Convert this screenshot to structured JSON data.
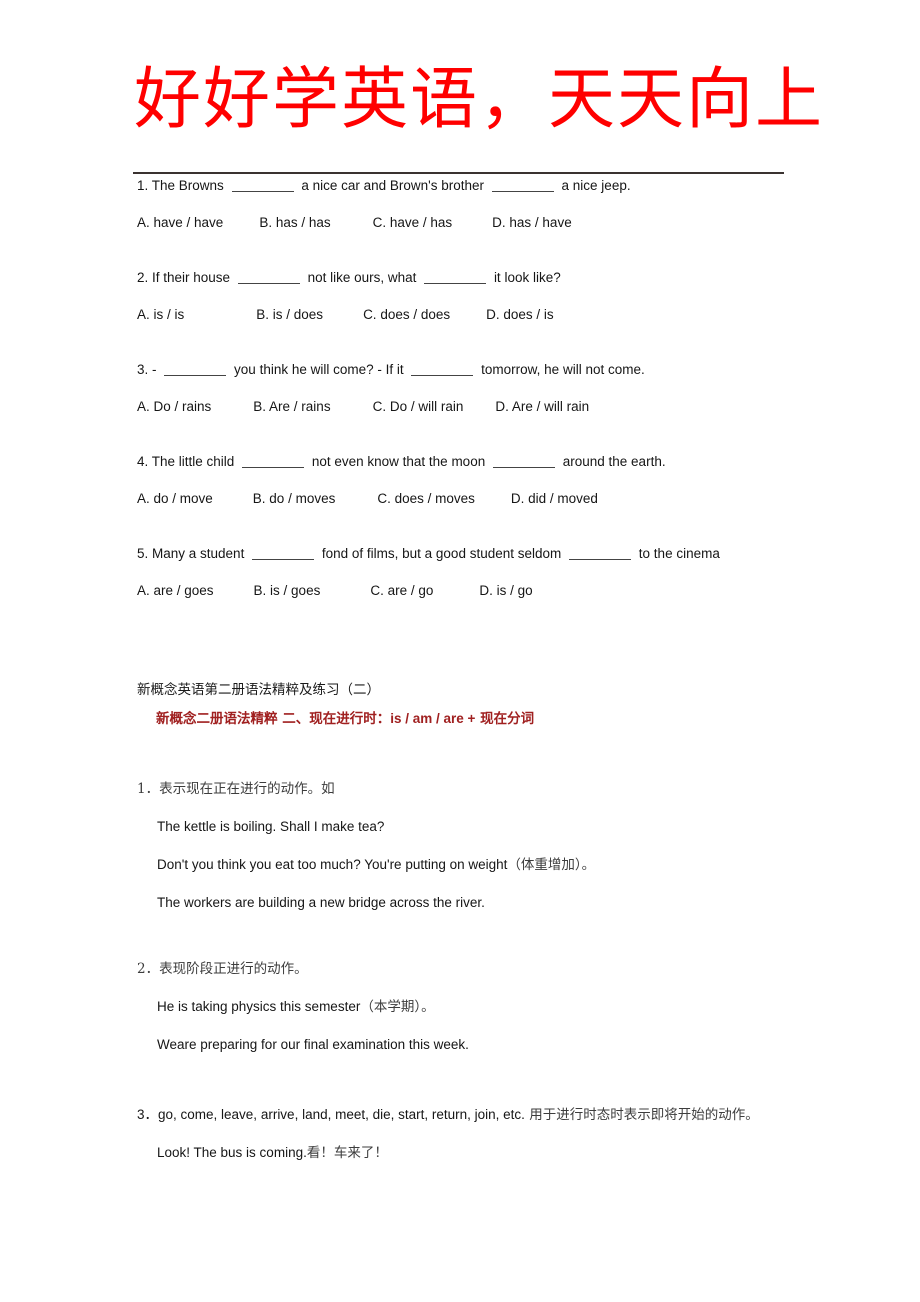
{
  "title": "好好学英语，天天向上",
  "quiz": [
    {
      "stem_parts": [
        "1. The Browns",
        "a nice car and Brown's brother",
        "a nice jeep."
      ],
      "options": [
        "A. have / have",
        "B. has / has",
        "C. have / has",
        "D. has / have"
      ]
    },
    {
      "stem_parts": [
        "2. If their house",
        "not like ours, what",
        "it look like?"
      ],
      "options": [
        "A. is / is",
        "B. is / does",
        "C. does / does",
        "D. does / is"
      ]
    },
    {
      "stem_parts": [
        "3. -",
        "you think he will come? - If it",
        "tomorrow, he will not come."
      ],
      "options": [
        "A. Do / rains",
        "B. Are / rains",
        "C. Do / will rain",
        "D. Are / will rain"
      ]
    },
    {
      "stem_parts": [
        "4. The little child",
        "not even know that the moon",
        "around the earth."
      ],
      "options": [
        "A. do / move",
        "B. do / moves",
        "C. does / moves",
        "D. did / moved"
      ]
    },
    {
      "stem_parts": [
        "5. Many a student",
        "fond of films, but a good student seldom",
        "to the cinema"
      ],
      "options": [
        "A. are / goes",
        "B. is / goes",
        "C. are / go",
        "D. is / go"
      ]
    }
  ],
  "section": {
    "subtitle": "新概念英语第二册语法精粹及练习（二）",
    "heading_prefix": "新概念二册语法精粹 二、现在进行时：",
    "heading_en": "is / am / are +",
    "heading_suffix": " 现在分词"
  },
  "notes": [
    {
      "num": "1．表示现在正在进行的动作。如",
      "lines": [
        {
          "en": "The kettle is boiling. Shall I make tea?",
          "cn": ""
        },
        {
          "en": "Don't you think you eat too much? You're putting on weight",
          "cn": "（体重增加）。"
        },
        {
          "en": "The workers are building a new bridge across the river.",
          "cn": ""
        }
      ]
    },
    {
      "num": "2．表现阶段正进行的动作。",
      "lines": [
        {
          "en": "He is taking physics this semester",
          "cn": "（本学期）。"
        },
        {
          "en": "Weare preparing for our final examination this week.",
          "cn": ""
        }
      ]
    },
    {
      "num_en": "3．go, come, leave, arrive, land, meet, die, start, return, join, etc.",
      "num_cn": " 用于进行时态时表示即将开始的动作。",
      "lines": [
        {
          "en": "Look! The bus is coming.",
          "cn": "看！车来了！"
        }
      ]
    }
  ]
}
